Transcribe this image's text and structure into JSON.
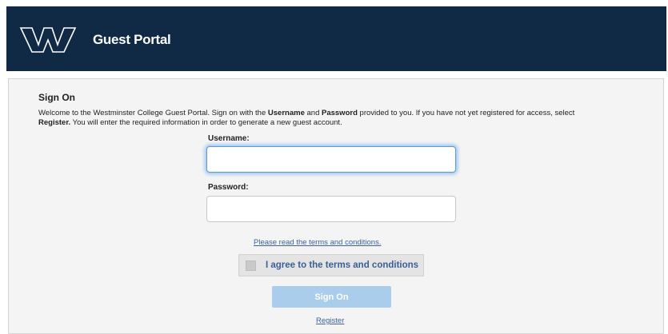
{
  "header": {
    "logo_icon": "westminster-w-logo",
    "title": "Guest Portal",
    "background": "#102a46"
  },
  "signon": {
    "title": "Sign On",
    "welcome": {
      "part1": "Welcome to the Westminster College Guest Portal. Sign on with the ",
      "username_word": "Username",
      "and_word": " and ",
      "password_word": "Password",
      "part2": " provided to you. If you have not yet registered for access, select ",
      "register_word": "Register.",
      "part3": " You will enter the required information in order to generate a new guest account."
    },
    "username_label": "Username:",
    "username_value": "",
    "password_label": "Password:",
    "password_value": "",
    "terms_link": "Please read the terms and conditions.",
    "agree_checked": false,
    "agree_label": "I agree to the terms and conditions",
    "signon_button": "Sign On",
    "register_link": "Register"
  },
  "colors": {
    "accent_link": "#3b62a3",
    "button_disabled": "#a9cdea"
  }
}
